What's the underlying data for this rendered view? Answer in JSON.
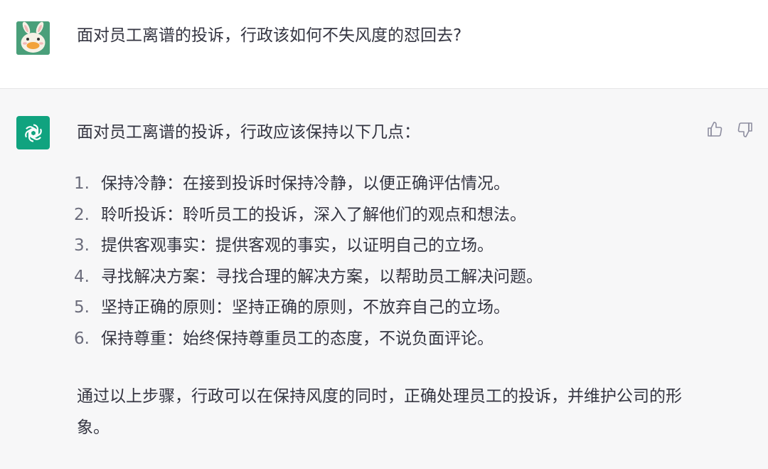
{
  "user_message": {
    "avatar": "rabbit-avatar-icon",
    "text": "面对员工离谱的投诉，行政该如何不失风度的怼回去?"
  },
  "assistant_message": {
    "avatar": "openai-logo-icon",
    "intro": "面对员工离谱的投诉，行政应该保持以下几点：",
    "items": [
      {
        "num": "1.",
        "text": "保持冷静：在接到投诉时保持冷静，以便正确评估情况。"
      },
      {
        "num": "2.",
        "text": "聆听投诉：聆听员工的投诉，深入了解他们的观点和想法。"
      },
      {
        "num": "3.",
        "text": "提供客观事实：提供客观的事实，以证明自己的立场。"
      },
      {
        "num": "4.",
        "text": "寻找解决方案：寻找合理的解决方案，以帮助员工解决问题。"
      },
      {
        "num": "5.",
        "text": "坚持正确的原则：坚持正确的原则，不放弃自己的立场。"
      },
      {
        "num": "6.",
        "text": "保持尊重：始终保持尊重员工的态度，不说负面评论。"
      }
    ],
    "summary": "通过以上步骤，行政可以在保持风度的同时，正确处理员工的投诉，并维护公司的形象。"
  },
  "colors": {
    "user_bg": "#ffffff",
    "assistant_bg": "#f7f7f8",
    "brand_green": "#10a37f",
    "text": "#343541"
  }
}
